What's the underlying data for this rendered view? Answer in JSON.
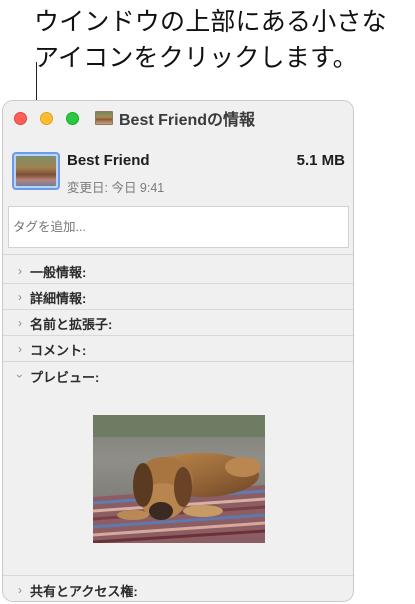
{
  "callout": {
    "text": "ウインドウの上部にある小さな\nアイコンをクリックします。"
  },
  "window": {
    "title": "Best Friendの情報",
    "title_icon": "photo-file-icon"
  },
  "file": {
    "name": "Best Friend",
    "size": "5.1 MB",
    "modified": "変更日: 今日 9:41"
  },
  "tags": {
    "placeholder": "タグを追加..."
  },
  "sections": [
    {
      "label": "一般情報:",
      "state": "collapsed"
    },
    {
      "label": "詳細情報:",
      "state": "collapsed"
    },
    {
      "label": "名前と拡張子:",
      "state": "collapsed"
    },
    {
      "label": "コメント:",
      "state": "collapsed"
    },
    {
      "label": "プレビュー:",
      "state": "expanded"
    },
    {
      "label": "共有とアクセス権:",
      "state": "collapsed"
    }
  ],
  "colors": {
    "close": "#fe5f57",
    "minimize": "#febc2e",
    "zoom": "#28c840",
    "selection": "#6b9be8"
  }
}
